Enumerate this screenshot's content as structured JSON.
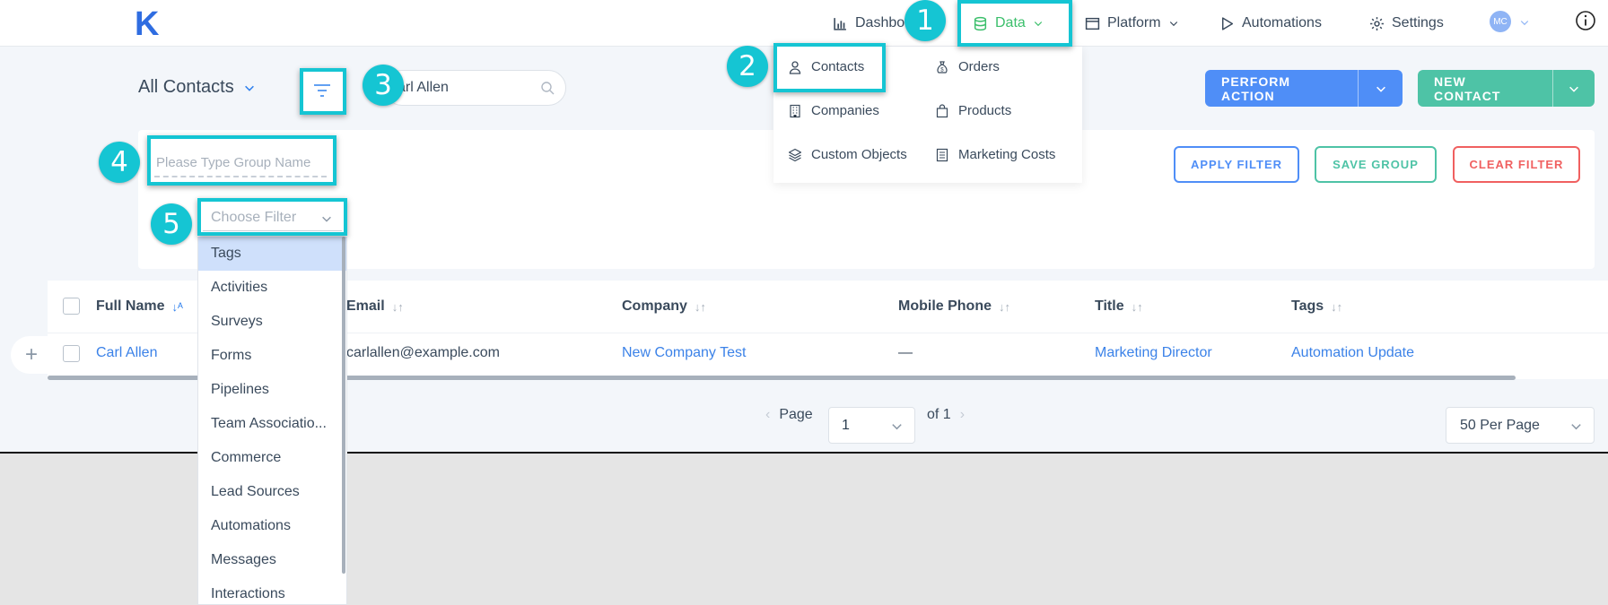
{
  "topbar": {
    "logo": "K",
    "nav": [
      {
        "label": "Dashbo",
        "icon": "bar-chart-icon"
      },
      {
        "label": "Data",
        "icon": "database-icon"
      },
      {
        "label": "Platform",
        "icon": "window-icon"
      },
      {
        "label": "Automations",
        "icon": "play-icon"
      },
      {
        "label": "Settings",
        "icon": "gear-icon"
      }
    ],
    "avatar": "MC",
    "accent": "#3bbf6b"
  },
  "data_menu": {
    "items": [
      {
        "label": "Contacts",
        "icon": "person-icon"
      },
      {
        "label": "Orders",
        "icon": "money-bag-icon"
      },
      {
        "label": "Companies",
        "icon": "building-icon"
      },
      {
        "label": "Products",
        "icon": "shopping-bag-icon"
      },
      {
        "label": "Custom Objects",
        "icon": "layers-icon"
      },
      {
        "label": "Marketing Costs",
        "icon": "receipt-icon"
      }
    ]
  },
  "header": {
    "title": "All Contacts",
    "search_value": "arl Allen",
    "perform_action": "PERFORM ACTION",
    "new_contact": "NEW CONTACT"
  },
  "filter": {
    "group_placeholder": "Please Type Group Name",
    "choose_filter": "Choose Filter",
    "apply": "APPLY FILTER",
    "save": "SAVE GROUP",
    "clear": "CLEAR FILTER",
    "options": [
      "Tags",
      "Activities",
      "Surveys",
      "Forms",
      "Pipelines",
      "Team Associatio...",
      "Commerce",
      "Lead Sources",
      "Automations",
      "Messages",
      "Interactions"
    ]
  },
  "table": {
    "columns": [
      "Full Name",
      "Email",
      "Company",
      "Mobile Phone",
      "Title",
      "Tags"
    ],
    "rows": [
      {
        "full_name": "Carl Allen",
        "email": "carlallen@example.com",
        "company": "New Company Test",
        "mobile": "—",
        "title": "Marketing Director",
        "tags": "Automation Update"
      }
    ]
  },
  "pagination": {
    "page_label": "Page",
    "page_value": "1",
    "of_label": "of 1",
    "per_page": "50 Per Page"
  },
  "callouts": [
    "1",
    "2",
    "3",
    "4",
    "5"
  ],
  "colors": {
    "primary": "#4f8ef7",
    "teal": "#4ec3a6",
    "red": "#f06060",
    "highlight": "#15c5d3"
  }
}
